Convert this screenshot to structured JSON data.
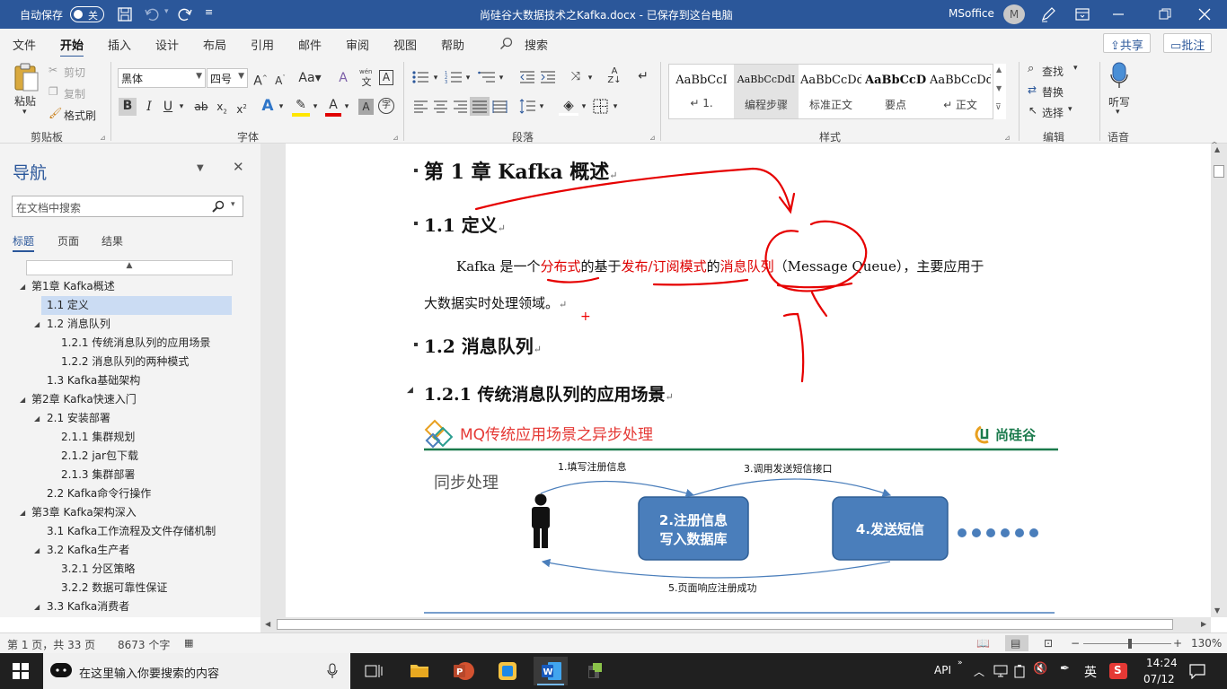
{
  "colors": {
    "accent": "#2b579a",
    "ink_red": "#e60000",
    "ribbon_bg": "#f3f3f3",
    "slide_box": "#4a7ebb",
    "slide_title_red": "#e53935",
    "brand_green": "#1a7a4c"
  },
  "titlebar": {
    "autosave_label": "自动保存",
    "autosave_state": "关",
    "doc_title": "尚硅谷大数据技术之Kafka.docx - 已保存到这台电脑",
    "user_name": "MSoffice",
    "user_initial": "M"
  },
  "menu": {
    "tabs": [
      "文件",
      "开始",
      "插入",
      "设计",
      "布局",
      "引用",
      "邮件",
      "审阅",
      "视图",
      "帮助"
    ],
    "active": "开始",
    "search_label": "搜索",
    "share": "共享",
    "comments": "批注"
  },
  "ribbon": {
    "clipboard": {
      "paste": "粘贴",
      "cut": "剪切",
      "copy": "复制",
      "format_painter": "格式刷",
      "group": "剪贴板"
    },
    "font": {
      "font_name": "黑体",
      "font_size": "四号",
      "group": "字体",
      "phonetic": "wén"
    },
    "paragraph": {
      "group": "段落"
    },
    "styles": {
      "group": "样式",
      "items": [
        {
          "preview": "AaBbCcI",
          "name": "↵ 1."
        },
        {
          "preview": "AaBbCcDdI",
          "name": "编程步骤"
        },
        {
          "preview": "AaBbCcDd",
          "name": "标准正文"
        },
        {
          "preview": "AaBbCcD",
          "name": "要点"
        },
        {
          "preview": "AaBbCcDd",
          "name": "↵ 正文"
        }
      ]
    },
    "editing": {
      "find": "查找",
      "replace": "替换",
      "select": "选择",
      "group": "编辑"
    },
    "voice": {
      "dictate": "听写",
      "group": "语音"
    }
  },
  "nav": {
    "title": "导航",
    "search_placeholder": "在文档中搜索",
    "tabs": [
      "标题",
      "页面",
      "结果"
    ],
    "items": [
      {
        "label": "第1章 Kafka概述",
        "level": 1,
        "expanded": true
      },
      {
        "label": "1.1 定义",
        "level": 2,
        "selected": true
      },
      {
        "label": "1.2 消息队列",
        "level": 2,
        "expanded": true
      },
      {
        "label": "1.2.1 传统消息队列的应用场景",
        "level": 3
      },
      {
        "label": "1.2.2 消息队列的两种模式",
        "level": 3
      },
      {
        "label": "1.3 Kafka基础架构",
        "level": 2
      },
      {
        "label": "第2章 Kafka快速入门",
        "level": 1,
        "expanded": true
      },
      {
        "label": "2.1 安装部署",
        "level": 2,
        "expanded": true
      },
      {
        "label": "2.1.1 集群规划",
        "level": 3
      },
      {
        "label": "2.1.2 jar包下载",
        "level": 3
      },
      {
        "label": "2.1.3 集群部署",
        "level": 3
      },
      {
        "label": "2.2 Kafka命令行操作",
        "level": 2
      },
      {
        "label": "第3章 Kafka架构深入",
        "level": 1,
        "expanded": true
      },
      {
        "label": "3.1 Kafka工作流程及文件存储机制",
        "level": 2
      },
      {
        "label": "3.2 Kafka生产者",
        "level": 2,
        "expanded": true
      },
      {
        "label": "3.2.1 分区策略",
        "level": 3
      },
      {
        "label": "3.2.2 数据可靠性保证",
        "level": 3
      },
      {
        "label": "3.3 Kafka消费者",
        "level": 2,
        "expanded": true
      }
    ]
  },
  "doc": {
    "ch1": "第 1 章  Kafka 概述",
    "h11": "1.1  定义",
    "p1": {
      "a": "Kafka 是一个",
      "b": "分布式",
      "c": "的基于",
      "d": "发布/订阅模式",
      "e": "的",
      "f": "消息队列",
      "g": "（Message Queue），主要应用于"
    },
    "p2": "大数据实时处理领域。",
    "h12": "1.2  消息队列",
    "h121": "1.2.1  传统消息队列的应用场景",
    "slide": {
      "title": "MQ传统应用场景之异步处理",
      "brand": "尚硅谷",
      "sync_label": "同步处理",
      "step1": "1.填写注册信息",
      "step2_l1": "2.注册信息",
      "step2_l2": "写入数据库",
      "step3": "3.调用发送短信接口",
      "step4": "4.发送短信",
      "step5": "5.页面响应注册成功"
    }
  },
  "status": {
    "page": "第 1 页，共 33 页",
    "words": "8673 个字",
    "zoom": "130%"
  },
  "taskbar": {
    "search_placeholder": "在这里输入你要搜索的内容",
    "api": "API",
    "ime": "英",
    "time": "14:24",
    "date": "07/12"
  }
}
